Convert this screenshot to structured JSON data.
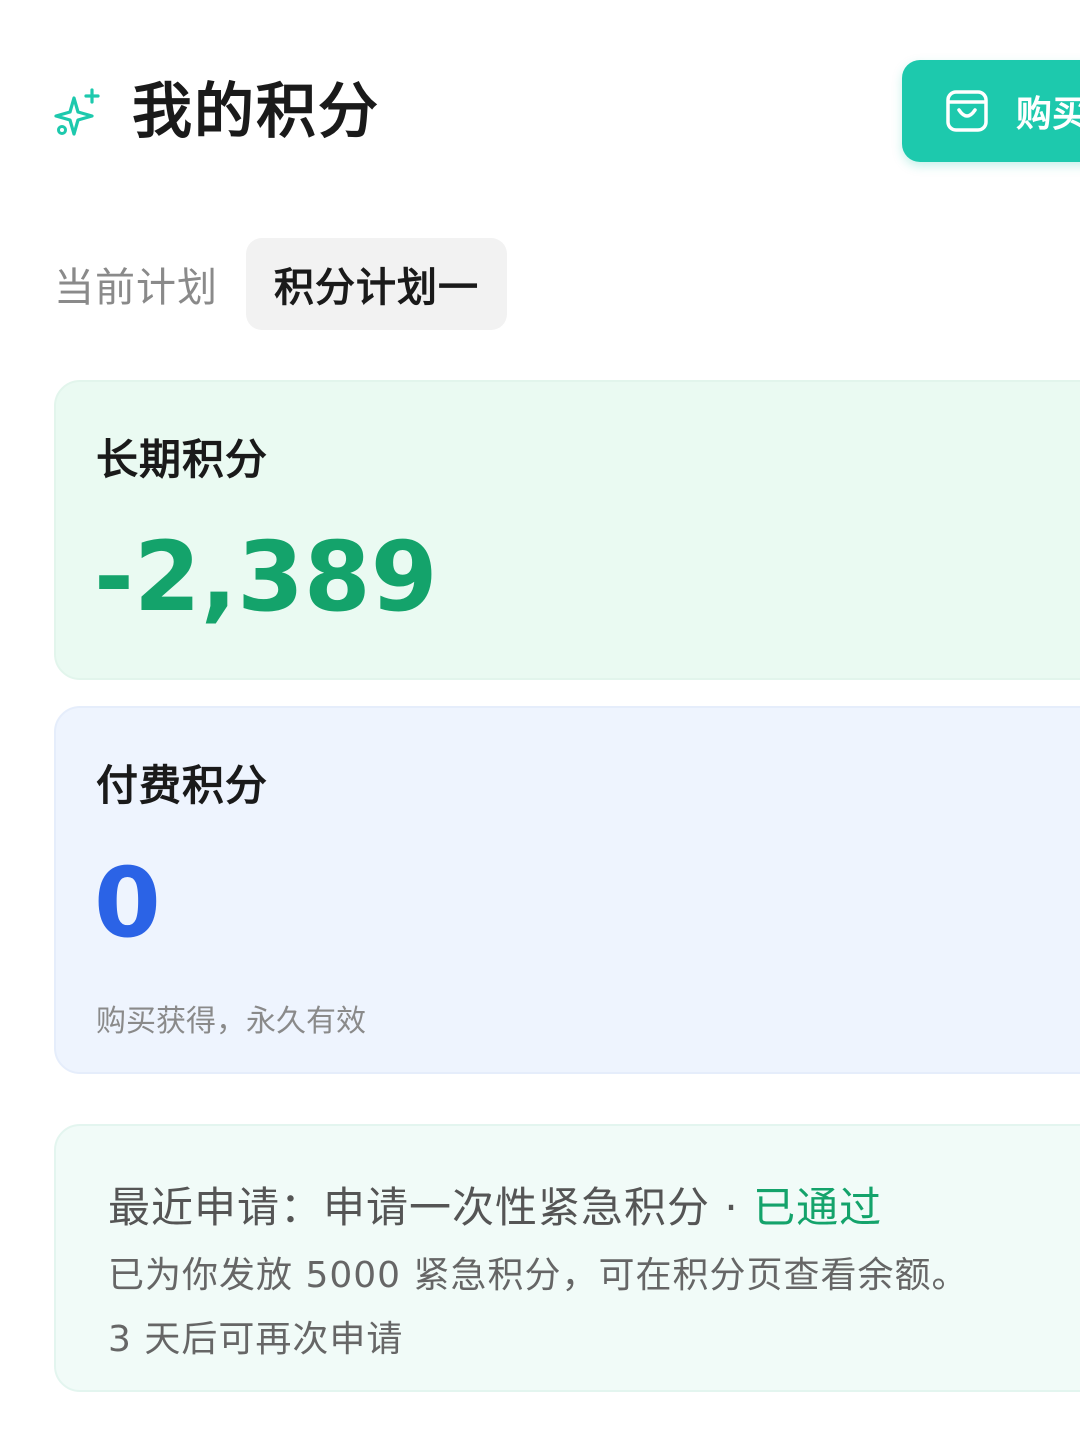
{
  "header": {
    "title": "我的积分",
    "buy_button_label": "购买",
    "icons": {
      "title": "sparkle-icon",
      "buy": "shopping-bag-icon"
    },
    "accent_color": "#1dc9ad"
  },
  "plan": {
    "label": "当前计划",
    "current": "积分计划一"
  },
  "long_term": {
    "title": "长期积分",
    "value": "-2,389",
    "value_color": "#14a36b"
  },
  "paid": {
    "title": "付费积分",
    "value": "0",
    "note": "购买获得，永久有效",
    "value_color": "#2b63e6"
  },
  "request": {
    "prefix": "最近申请：",
    "type": "申请一次性紧急积分",
    "separator": " · ",
    "status": "已通过",
    "detail": "已为你发放 5000 紧急积分，可在积分页查看余额。",
    "cooldown": "3 天后可再次申请"
  }
}
